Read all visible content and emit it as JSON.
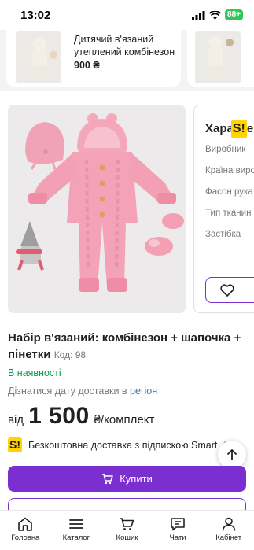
{
  "status_bar": {
    "time": "13:02",
    "battery": "88+"
  },
  "recommended": [
    {
      "title": "Дитячий в'язаний утеплений комбінезон",
      "price": "900 ₴"
    },
    {
      "title": "",
      "price": ""
    }
  ],
  "characteristics": {
    "title_prefix": "Хара",
    "title_suffix": "ер",
    "logo_letter": "S!",
    "labels": [
      "Виробник",
      "Країна виро",
      "Фасон рука",
      "Тип тканин",
      "Застібка"
    ]
  },
  "product": {
    "title": "Набір в'язаний: комбінезон + шапочка + пінетки",
    "code": "Код: 98",
    "availability": "В наявності",
    "delivery_prefix": "Дізнатися дату доставки в",
    "delivery_region": "регіон",
    "price_from": "від",
    "price_amount": "1 500",
    "price_unit": "₴/комплект",
    "smart_text": "Безкоштовна доставка з підпискою Smart",
    "smart_logo": "S!",
    "buy_label": "Купити"
  },
  "nav": [
    {
      "label": "Головна",
      "icon": "home-icon"
    },
    {
      "label": "Каталог",
      "icon": "menu-icon"
    },
    {
      "label": "Кошик",
      "icon": "cart-icon"
    },
    {
      "label": "Чати",
      "icon": "chat-icon"
    },
    {
      "label": "Кабінет",
      "icon": "user-icon"
    }
  ],
  "colors": {
    "accent": "#7b2fd1",
    "in_stock": "#00a046",
    "smart_yellow": "#ffd400",
    "region_link": "#3e77aa"
  }
}
